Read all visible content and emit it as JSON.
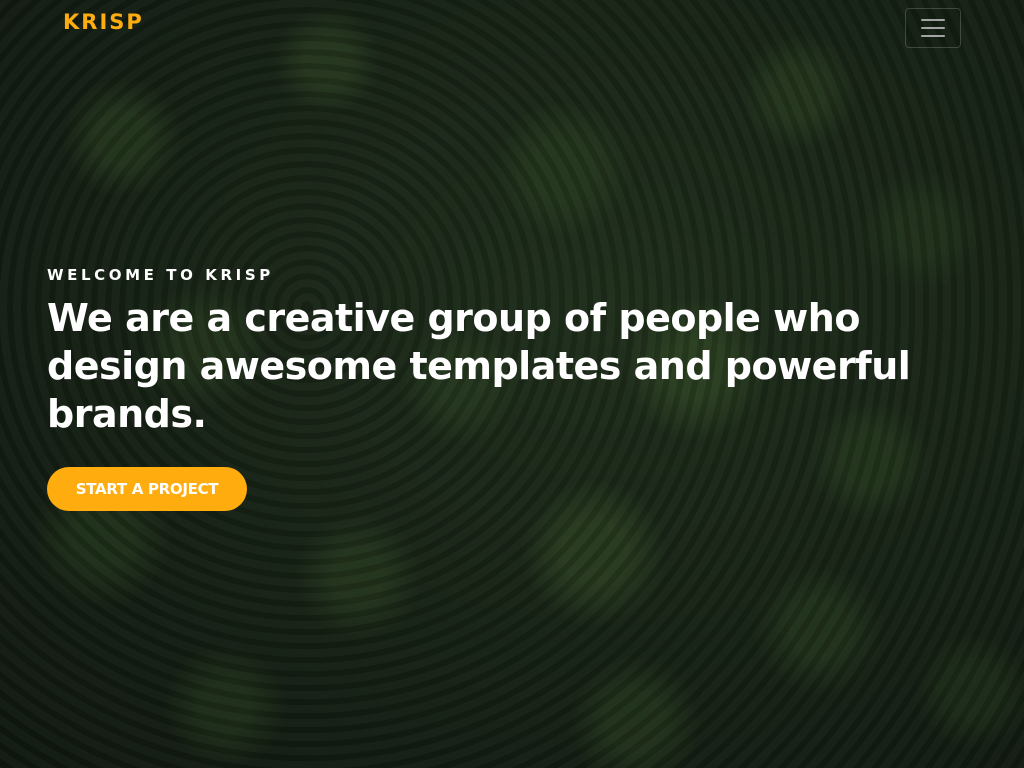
{
  "navbar": {
    "brand": "KRISP",
    "toggle_icon": "hamburger-menu-icon"
  },
  "hero": {
    "eyebrow": "WELCOME TO KRISP",
    "headline": "We are a creative group of people who design awesome templates and powerful brands.",
    "cta_label": "START A PROJECT"
  },
  "colors": {
    "accent": "#ffac0e",
    "text": "#ffffff",
    "background": "#1c2a1c"
  }
}
